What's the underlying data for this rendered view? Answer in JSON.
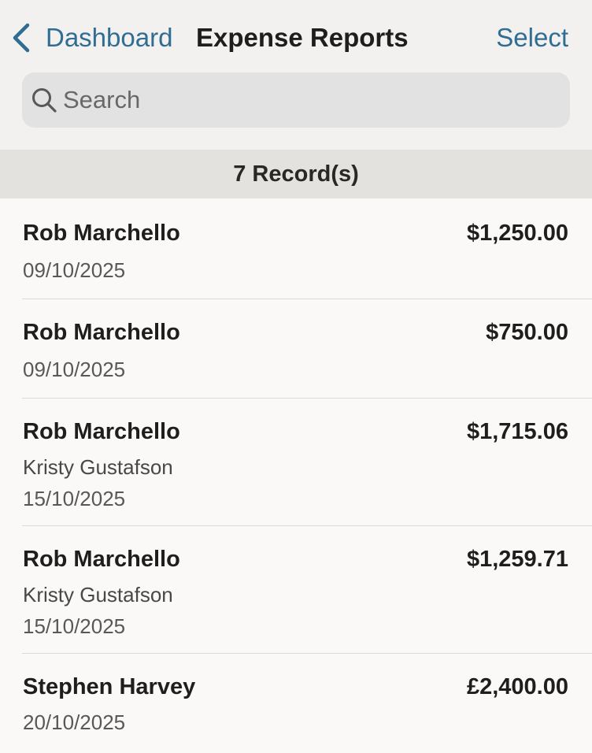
{
  "header": {
    "back_label": "Dashboard",
    "title": "Expense Reports",
    "select_label": "Select",
    "back_icon": "chevron-left-icon",
    "accent_color": "#2f6d93"
  },
  "search": {
    "placeholder": "Search",
    "value": "",
    "icon": "search-icon"
  },
  "records": {
    "count_label": "7 Record(s)"
  },
  "items": [
    {
      "name": "Rob Marchello",
      "approver": "",
      "date": "09/10/2025",
      "amount": "$1,250.00"
    },
    {
      "name": "Rob Marchello",
      "approver": "",
      "date": "09/10/2025",
      "amount": "$750.00"
    },
    {
      "name": "Rob Marchello",
      "approver": "Kristy Gustafson",
      "date": "15/10/2025",
      "amount": "$1,715.06"
    },
    {
      "name": "Rob Marchello",
      "approver": "Kristy Gustafson",
      "date": "15/10/2025",
      "amount": "$1,259.71"
    },
    {
      "name": "Stephen Harvey",
      "approver": "",
      "date": "20/10/2025",
      "amount": "£2,400.00"
    }
  ]
}
